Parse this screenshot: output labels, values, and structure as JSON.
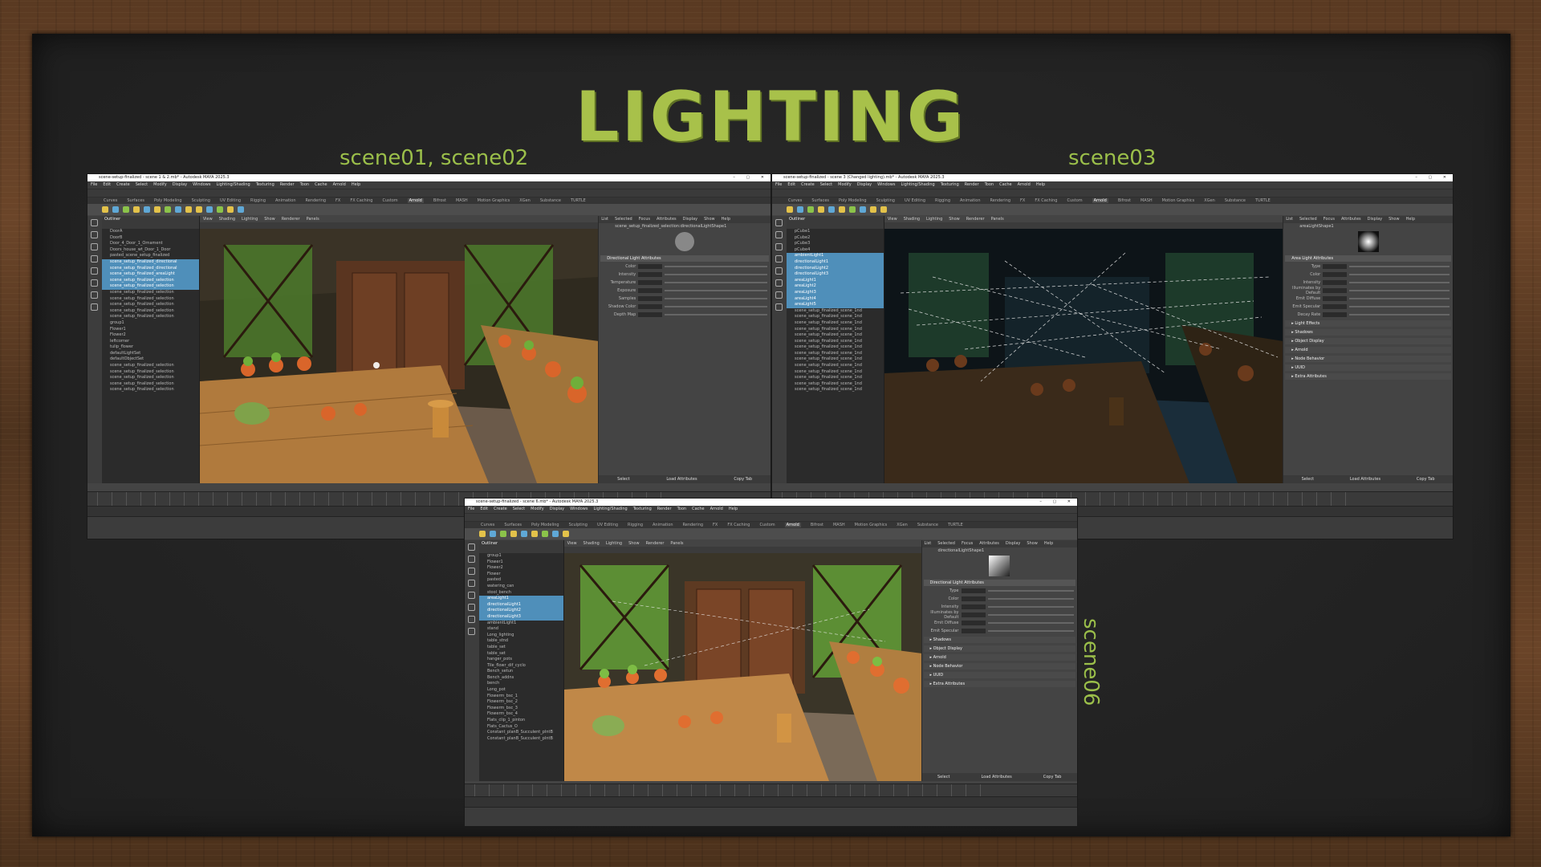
{
  "slide": {
    "title": "LIGHTING",
    "labels": {
      "scene_01_02": "scene01, scene02",
      "scene_03": "scene03",
      "scene_06": "scene06"
    }
  },
  "window_left": {
    "title": "scene-setup-finalized - scene 1 & 2.mb* - Autodesk MAYA 2025.3",
    "menu": [
      "File",
      "Edit",
      "Create",
      "Select",
      "Modify",
      "Display",
      "Windows",
      "Lighting/Shading",
      "Texturing",
      "Render",
      "Toon",
      "Cache",
      "Arnold",
      "Help"
    ],
    "shelf_tabs": [
      "Curves",
      "Surfaces",
      "Poly Modeling",
      "Sculpting",
      "UV Editing",
      "Rigging",
      "Animation",
      "Rendering",
      "FX",
      "FX Caching",
      "Custom",
      "Arnold",
      "Bifrost",
      "MASH",
      "Motion Graphics",
      "XGen",
      "Substance",
      "TURTLE"
    ],
    "outliner_title": "Outliner",
    "outliner_rows": [
      "DoorA",
      "DoorB",
      "Door_4_Door_1_Ornament",
      "Doors_house_wt_Door_1_Door",
      "pasted_scene_setup_finalized",
      "scene_setup_finalized_directional",
      "scene_setup_finalized_directional",
      "scene_setup_finalized_areaLight",
      "scene_setup_finalized_selection",
      "scene_setup_finalized_selection",
      "scene_setup_finalized_selection",
      "scene_setup_finalized_selection",
      "scene_setup_finalized_selection",
      "scene_setup_finalized_selection",
      "scene_setup_finalized_selection",
      "group1",
      "Flower1",
      "Flower2",
      "leftcorner",
      "tulip_flower",
      "defaultLightSet",
      "defaultObjectSet",
      "scene_setup_finalized_selection",
      "scene_setup_finalized_selection",
      "scene_setup_finalized_selection",
      "scene_setup_finalized_selection",
      "scene_setup_finalized_selection"
    ],
    "selected_rows": [
      5,
      6,
      7,
      8,
      9
    ],
    "viewport_menu": [
      "View",
      "Shading",
      "Lighting",
      "Show",
      "Renderer",
      "Panels"
    ],
    "attr_tabs": [
      "List",
      "Selected",
      "Focus",
      "Attributes",
      "Display",
      "Show",
      "Help"
    ],
    "attr_node": "scene_setup_finalized_selection:directionalLightShape1",
    "attr_section": "Directional Light Attributes",
    "attr_fields": [
      "Color",
      "Intensity",
      "Temperature",
      "Exposure",
      "Samples",
      "Shadow Color",
      "Depth Map"
    ],
    "attr_buttons": [
      "Select",
      "Load Attributes",
      "Copy Tab"
    ]
  },
  "window_right": {
    "title": "scene-setup-finalized - scene 3 (Changed lighting).mb* - Autodesk MAYA 2025.3",
    "menu": [
      "File",
      "Edit",
      "Create",
      "Select",
      "Modify",
      "Display",
      "Windows",
      "Lighting/Shading",
      "Texturing",
      "Render",
      "Toon",
      "Cache",
      "Arnold",
      "Help"
    ],
    "outliner_title": "Outliner",
    "outliner_rows": [
      "pCube1",
      "pCube2",
      "pCube3",
      "pCube4",
      "ambientLight1",
      "directionalLight1",
      "directionalLight2",
      "directionalLight3",
      "areaLight1",
      "areaLight2",
      "areaLight3",
      "areaLight4",
      "areaLight5",
      "scene_setup_finalized_scene_1nd",
      "scene_setup_finalized_scene_1nd",
      "scene_setup_finalized_scene_1nd",
      "scene_setup_finalized_scene_1nd",
      "scene_setup_finalized_scene_1nd",
      "scene_setup_finalized_scene_1nd",
      "scene_setup_finalized_scene_1nd",
      "scene_setup_finalized_scene_1nd",
      "scene_setup_finalized_scene_1nd",
      "scene_setup_finalized_scene_1nd",
      "scene_setup_finalized_scene_1nd",
      "scene_setup_finalized_scene_1nd",
      "scene_setup_finalized_scene_1nd",
      "scene_setup_finalized_scene_1nd"
    ],
    "selected_rows": [
      4,
      5,
      6,
      7,
      8,
      9,
      10,
      11,
      12
    ],
    "attr_node": "areaLightShape1",
    "attr_section": "Area Light Attributes",
    "attr_fields": [
      "Type",
      "Color",
      "Intensity",
      "Illuminates by Default",
      "Emit Diffuse",
      "Emit Specular",
      "Decay Rate"
    ],
    "attr_sections_closed": [
      "Light Effects",
      "Shadows",
      "Object Display",
      "Arnold",
      "Node Behavior",
      "UUID",
      "Extra Attributes"
    ],
    "attr_buttons": [
      "Select",
      "Load Attributes",
      "Copy Tab"
    ]
  },
  "window_bottom": {
    "title": "scene-setup-finalized - scene 6.mb* - Autodesk MAYA 2025.3",
    "menu": [
      "File",
      "Edit",
      "Create",
      "Select",
      "Modify",
      "Display",
      "Windows",
      "Lighting/Shading",
      "Texturing",
      "Render",
      "Toon",
      "Cache",
      "Arnold",
      "Help"
    ],
    "outliner_title": "Outliner",
    "outliner_rows": [
      "group1",
      "Flower1",
      "Flower2",
      "Flower",
      "pasted",
      "watering_can",
      "stool_bench",
      "areaLight1",
      "directionalLight1",
      "directionalLight2",
      "directionalLight3",
      "ambientLight1",
      "stand",
      "Long_lighting",
      "table_stnd",
      "table_set",
      "table_set",
      "hanger_pots",
      "Tile_flowr_dif_cyclo",
      "Bench_setun",
      "Bench_addns",
      "bench",
      "Long_pot",
      "Flowerm_bsc_1",
      "Flowerm_bsc_2",
      "Flowerm_bsc_3",
      "Flowerm_bsc_4",
      "Flats_clip_1_pinton",
      "Flats_Cactus_O",
      "Constant_planB_Succulent_plntB",
      "Constant_planB_Succulent_plntB"
    ],
    "selected_rows": [
      7,
      8,
      9,
      10
    ],
    "attr_node": "directionalLightShape1",
    "attr_section": "Directional Light Attributes",
    "attr_fields": [
      "Type",
      "Color",
      "Intensity",
      "Illuminates by Default",
      "Emit Diffuse",
      "Emit Specular"
    ],
    "attr_sections_closed": [
      "Shadows",
      "Object Display",
      "Arnold",
      "Node Behavior",
      "UUID",
      "Extra Attributes"
    ],
    "attr_buttons": [
      "Select",
      "Load Attributes",
      "Copy Tab"
    ]
  },
  "colors": {
    "title": "#a8c14a",
    "label": "#9bbf4a",
    "board": "#262626",
    "frame": "#5a3a22",
    "selection": "#4f8fba"
  }
}
